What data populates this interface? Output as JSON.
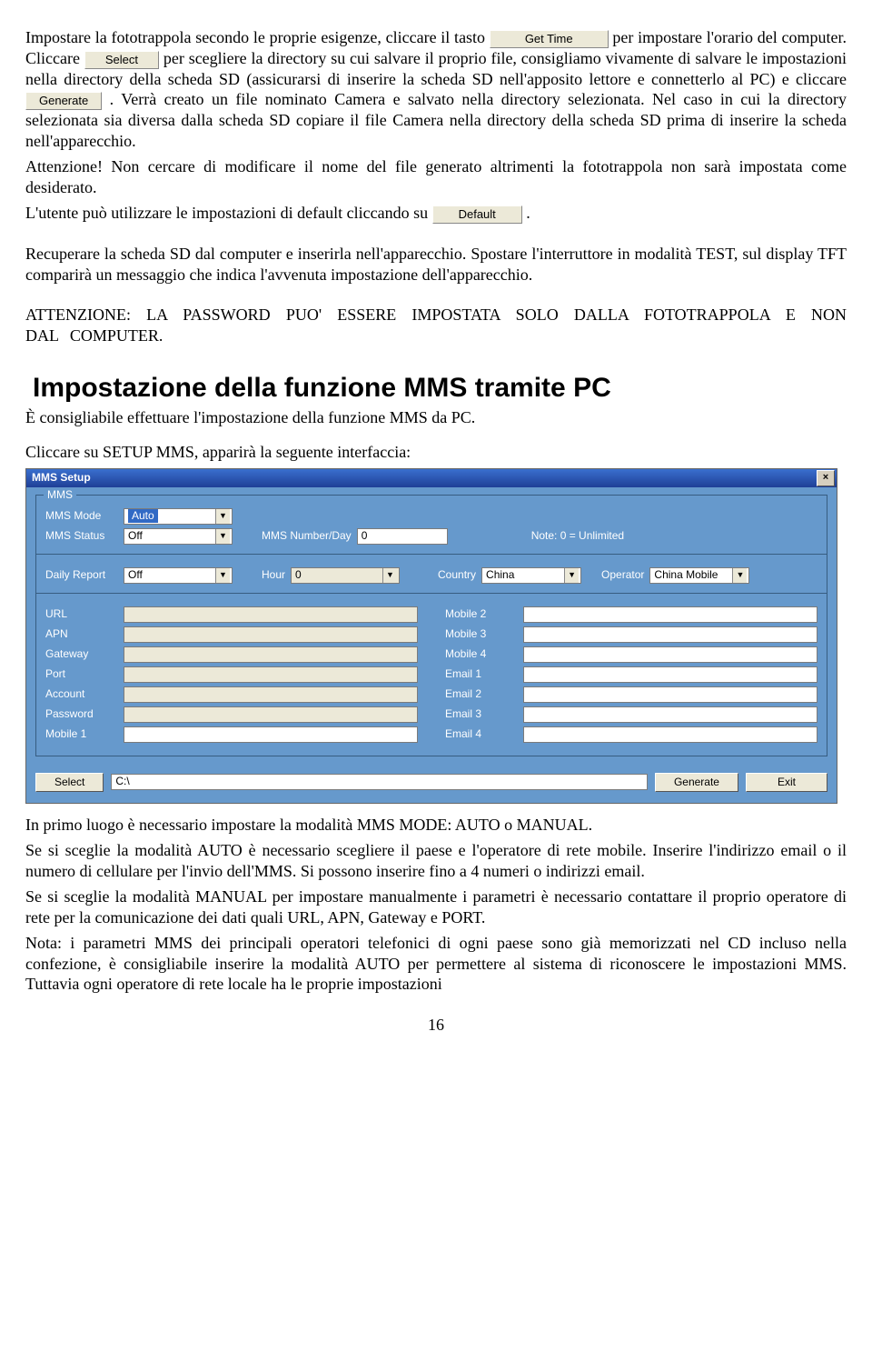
{
  "buttons": {
    "getTime": "Get Time",
    "select": "Select",
    "generate": "Generate",
    "default": "Default"
  },
  "para1a": "Impostare la fototrappola secondo le proprie esigenze, cliccare il tasto ",
  "para1b": " per impostare l'orario del computer. Cliccare ",
  "para1c": " per scegliere la directory su cui salvare il proprio file, consigliamo vivamente di salvare le impostazioni nella directory della scheda SD (assicurarsi di inserire la scheda SD nell'apposito lettore e connetterlo al PC) e cliccare ",
  "para1d": ". Verrà creato un file nominato Camera e salvato nella directory selezionata. Nel caso in cui la directory selezionata sia diversa dalla scheda SD copiare il file Camera nella directory della scheda SD prima di inserire la scheda nell'apparecchio.",
  "para2": "Attenzione! Non cercare di modificare il nome del file generato altrimenti la fototrappola non sarà impostata come desiderato.",
  "para3a": "L'utente può utilizzare le impostazioni di default cliccando su ",
  "para3b": ".",
  "para4": "Recuperare la scheda SD dal computer e inserirla nell'apparecchio. Spostare l'interruttore in modalità TEST, sul display TFT comparirà un messaggio che indica l'avvenuta impostazione dell'apparecchio.",
  "para5": "ATTENZIONE: LA PASSWORD PUO' ESSERE IMPOSTATA SOLO DALLA FOTOTRAPPOLA E NON DAL COMPUTER.",
  "heading": "Impostazione della funzione MMS tramite PC",
  "subhead": "È consigliabile effettuare l'impostazione della funzione MMS da PC.",
  "para6": "Cliccare su SETUP MMS, apparirà la seguente interfaccia:",
  "win": {
    "title": "MMS Setup",
    "group": "MMS",
    "labels": {
      "mmsMode": "MMS Mode",
      "mmsStatus": "MMS Status",
      "mmsNumDay": "MMS Number/Day",
      "note": "Note: 0 = Unlimited",
      "daily": "Daily Report",
      "hour": "Hour",
      "country": "Country",
      "operator": "Operator",
      "url": "URL",
      "apn": "APN",
      "gateway": "Gateway",
      "port": "Port",
      "account": "Account",
      "password": "Password",
      "mobile1": "Mobile 1",
      "mobile2": "Mobile 2",
      "mobile3": "Mobile 3",
      "mobile4": "Mobile 4",
      "email1": "Email 1",
      "email2": "Email 2",
      "email3": "Email 3",
      "email4": "Email 4"
    },
    "values": {
      "mmsMode": "Auto",
      "mmsStatus": "Off",
      "mmsNumDay": "0",
      "daily": "Off",
      "hour": "0",
      "country": "China",
      "operator": "China Mobile",
      "path": "C:\\"
    },
    "btns": {
      "select": "Select",
      "generate": "Generate",
      "exit": "Exit"
    }
  },
  "para7": "In  primo luogo è necessario impostare la modalità MMS MODE: AUTO o MANUAL.",
  "para8": "Se si sceglie la modalità AUTO è necessario scegliere il paese e l'operatore di rete mobile. Inserire l'indirizzo email o il numero di cellulare per l'invio dell'MMS. Si possono inserire fino a 4 numeri o indirizzi email.",
  "para9": "Se si sceglie la modalità MANUAL per impostare manualmente i parametri è necessario contattare il proprio operatore di rete per la comunicazione dei dati quali URL, APN, Gateway e PORT.",
  "para10": "Nota: i parametri MMS dei principali operatori telefonici di ogni paese sono già memorizzati nel CD incluso nella confezione, è consigliabile inserire la modalità AUTO per permettere al sistema di riconoscere le impostazioni MMS. Tuttavia ogni operatore di rete locale ha le proprie impostazioni",
  "pageNum": "16"
}
